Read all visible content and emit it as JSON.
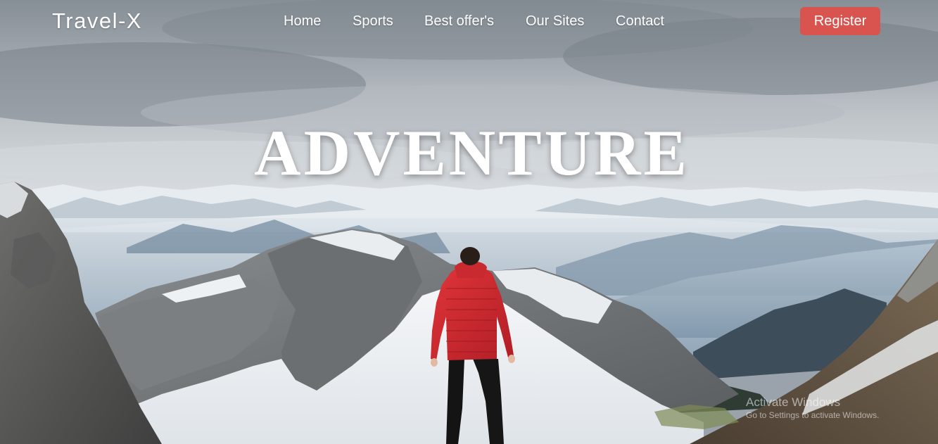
{
  "navbar": {
    "brand": "Travel-X",
    "links": [
      {
        "label": "Home"
      },
      {
        "label": "Sports"
      },
      {
        "label": "Best offer's"
      },
      {
        "label": "Our Sites"
      },
      {
        "label": "Contact"
      }
    ],
    "register_label": "Register"
  },
  "hero": {
    "title": "ADVENTURE"
  },
  "watermark": {
    "title": "Activate Windows",
    "subtitle": "Go to Settings to activate Windows."
  },
  "colors": {
    "register_button": "#d9534f",
    "nav_text": "#ffffff",
    "jacket": "#d42a31"
  },
  "icons": []
}
